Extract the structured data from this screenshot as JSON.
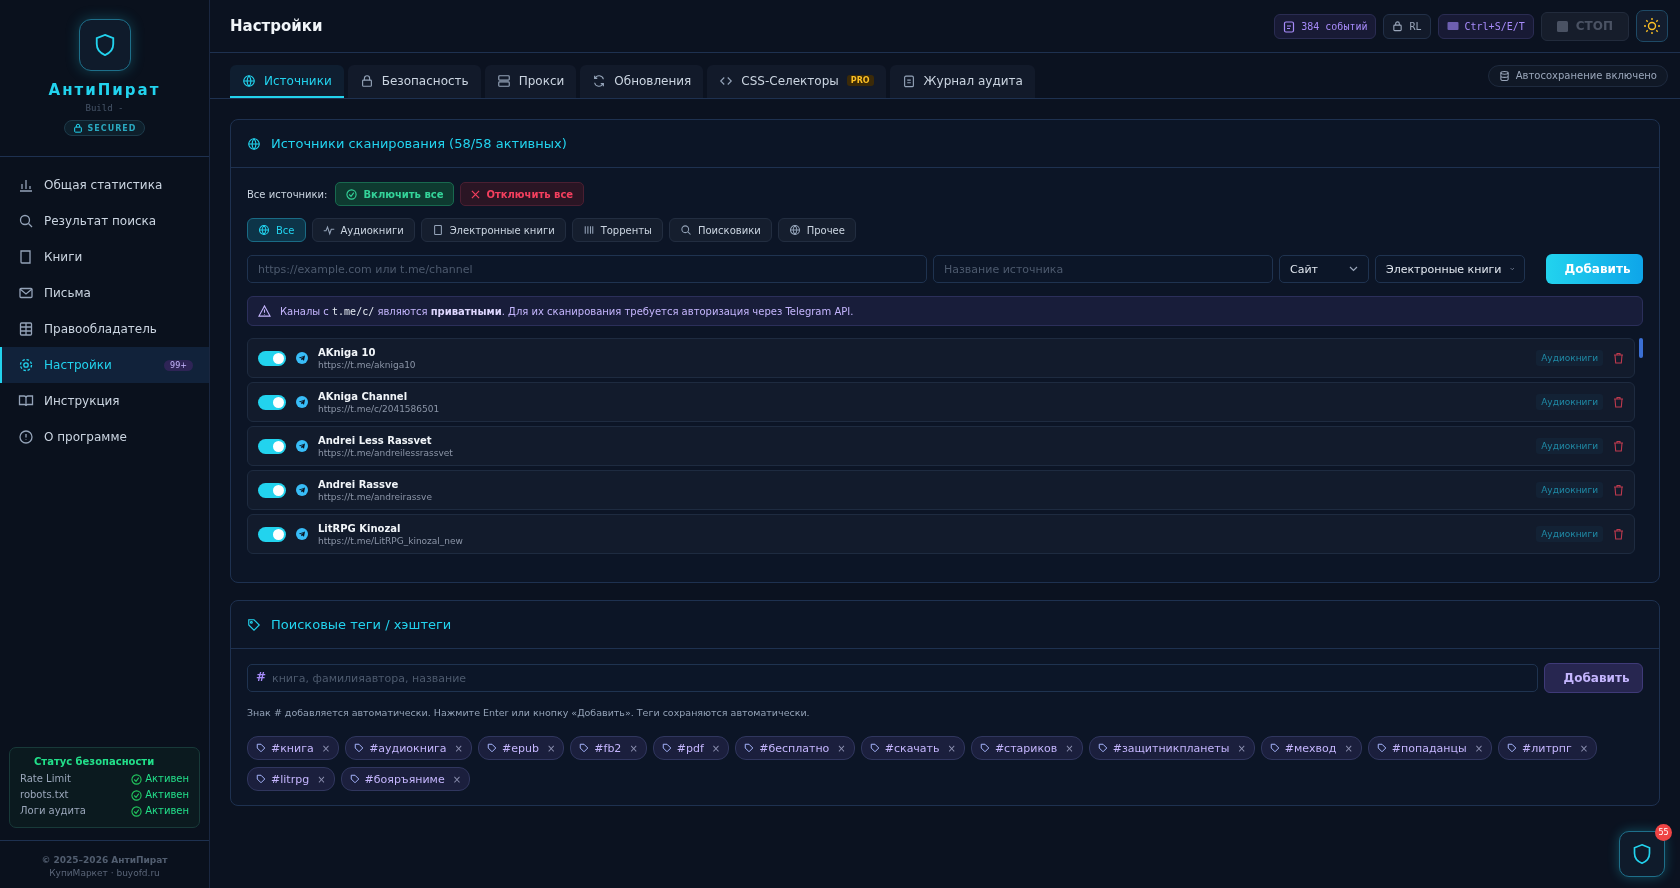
{
  "sidebar": {
    "app_name": "АнтиПират",
    "build": "Build -",
    "badge": "SECURED",
    "items": [
      {
        "label": "Общая статистика",
        "selected": false
      },
      {
        "label": "Результат поиска",
        "selected": false
      },
      {
        "label": "Книги",
        "selected": false
      },
      {
        "label": "Письма",
        "selected": false
      },
      {
        "label": "Правообладатель",
        "selected": false
      },
      {
        "label": "Настройки",
        "selected": true,
        "badge": "99+"
      },
      {
        "label": "Инструкция",
        "selected": false
      },
      {
        "label": "О программе",
        "selected": false
      }
    ],
    "security_status": {
      "title": "Статус безопасности",
      "rows": [
        {
          "label": "Rate Limit",
          "status": "Активен"
        },
        {
          "label": "robots.txt",
          "status": "Активен"
        },
        {
          "label": "Логи аудита",
          "status": "Активен"
        }
      ]
    },
    "footer": [
      "© 2025–2026 АнтиПират",
      "КупиМаркет · buyofd.ru"
    ]
  },
  "header": {
    "title": "Настройки",
    "events": "384 событий",
    "rl": "RL",
    "shortcut": "Ctrl+S/E/T",
    "stop": "СТОП",
    "stop_disabled": true
  },
  "tabs": [
    {
      "label": "Источники",
      "selected": true
    },
    {
      "label": "Безопасность",
      "selected": false
    },
    {
      "label": "Прокси",
      "selected": false
    },
    {
      "label": "Обновления",
      "selected": false
    },
    {
      "label": "CSS-Селекторы",
      "selected": false,
      "badge": "PRO"
    },
    {
      "label": "Журнал аудита",
      "selected": false
    }
  ],
  "autosave": "Автосохранение включено",
  "sources": {
    "title": "Источники сканирования (58/58 активных)",
    "all_label": "Все источники:",
    "enable_all": "Включить все",
    "disable_all": "Отключить все",
    "filters": [
      {
        "label": "Все",
        "selected": true
      },
      {
        "label": "Аудиокниги",
        "selected": false
      },
      {
        "label": "Электронные книги",
        "selected": false
      },
      {
        "label": "Торренты",
        "selected": false
      },
      {
        "label": "Поисковики",
        "selected": false
      },
      {
        "label": "Прочее",
        "selected": false
      }
    ],
    "url_placeholder": "https://example.com или t.me/channel",
    "name_placeholder": "Название источника",
    "type_select": "Сайт",
    "category_select": "Электронные книги",
    "add": "Добавить",
    "notice_before": "Каналы с",
    "notice_code": "t.me/c/",
    "notice_after": "являются **приватными**. Для их сканирования требуется авторизация через Telegram API.",
    "items": [
      {
        "name": "AKniga 10",
        "url": "https://t.me/akniga10",
        "category": "Аудиокниги",
        "on": true
      },
      {
        "name": "AKniga Channel",
        "url": "https://t.me/c/2041586501",
        "category": "Аудиокниги",
        "on": true
      },
      {
        "name": "Andrei Less Rassvet",
        "url": "https://t.me/andreilessrassvet",
        "category": "Аудиокниги",
        "on": true
      },
      {
        "name": "Andrei Rassve",
        "url": "https://t.me/andreirassve",
        "category": "Аудиокниги",
        "on": true
      },
      {
        "name": "LitRPG Kinozal",
        "url": "https://t.me/LitRPG_kinozal_new",
        "category": "Аудиокниги",
        "on": true
      }
    ]
  },
  "tags": {
    "title": "Поисковые теги / хэштеги",
    "prefix": "#",
    "placeholder": "книга, фамилияавтора, название",
    "add": "Добавить",
    "hint": "Знак # добавляется автоматически. Нажмите Enter или кнопку «Добавить». Теги сохраняются автоматически.",
    "items": [
      "#книга",
      "#аудиокнига",
      "#epub",
      "#fb2",
      "#pdf",
      "#бесплатно",
      "#скачать",
      "#стариков",
      "#защитникпланеты",
      "#мехвод",
      "#попаданцы",
      "#литрпг",
      "#litrpg",
      "#бояръяниме"
    ],
    "remove": "×"
  },
  "fab_badge": "55"
}
